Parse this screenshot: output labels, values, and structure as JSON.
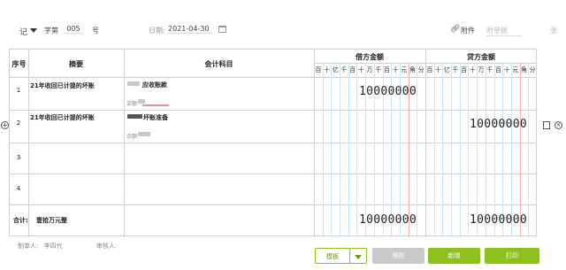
{
  "header": {
    "voucher_word": "记",
    "zi_label": "字第",
    "number": "005",
    "hao_label": "号",
    "date_label": "日期:",
    "date_value": "2021-04-30",
    "attachment_label": "附件",
    "attachment_count_placeholder": "附单据",
    "zhang_label": "张"
  },
  "table": {
    "headers": {
      "seq": "序号",
      "summary": "摘要",
      "account": "会计科目",
      "debit": "借方金额",
      "credit": "贷方金额"
    },
    "units": [
      "百",
      "十",
      "亿",
      "千",
      "百",
      "十",
      "万",
      "千",
      "百",
      "十",
      "元",
      "角",
      "分"
    ],
    "rows": [
      {
        "seq": "1",
        "summary": "21年收回已计提的坏账",
        "account": "应收账款",
        "balance_label": "余额:",
        "debit": "10000000",
        "credit": ""
      },
      {
        "seq": "2",
        "summary": "21年收回已计提的坏账",
        "account": "坏账准备",
        "balance_label": "余额:",
        "debit": "",
        "credit": "10000000"
      },
      {
        "seq": "3",
        "summary": "",
        "account": "",
        "balance_label": "",
        "debit": "",
        "credit": ""
      },
      {
        "seq": "4",
        "summary": "",
        "account": "",
        "balance_label": "",
        "debit": "",
        "credit": ""
      }
    ],
    "total": {
      "label": "合计:",
      "amount_words": "壹拾万元整",
      "debit": "10000000",
      "credit": "10000000"
    }
  },
  "footer": {
    "maker_label": "制单人:",
    "maker_name": "李四代",
    "reviewer_label": "审核人:"
  },
  "buttons": {
    "template": "模板",
    "save": "保存",
    "new": "新增",
    "print": "打印"
  },
  "colors": {
    "accent_green": "#8ec11e",
    "disabled_gray": "#c9c9c9",
    "yuan_line_red": "#f3b3b3",
    "digit_line_blue": "#cde6f5"
  }
}
